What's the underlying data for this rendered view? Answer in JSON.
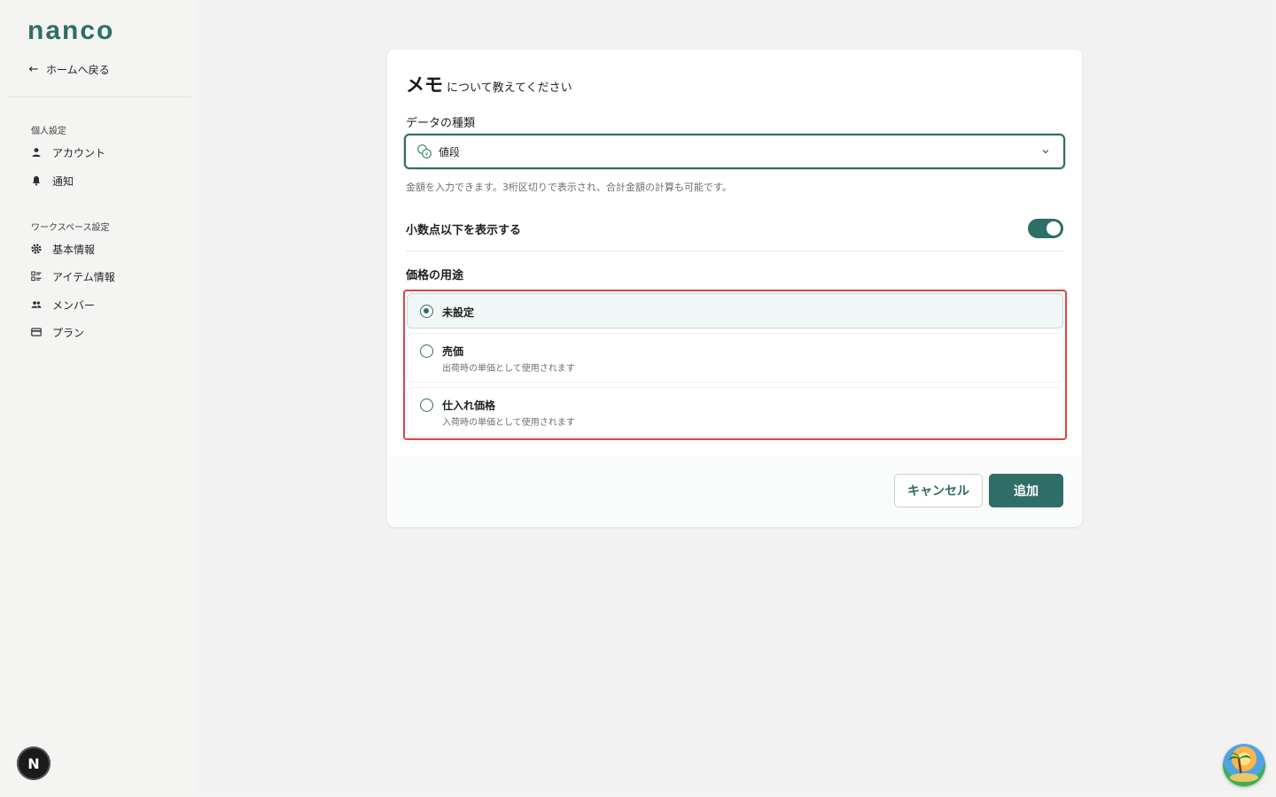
{
  "sidebar": {
    "logo": "nanco",
    "back_label": "ホームへ戻る",
    "personal_section": "個人設定",
    "personal_items": [
      {
        "label": "アカウント",
        "icon": "person-icon"
      },
      {
        "label": "通知",
        "icon": "bell-icon"
      }
    ],
    "workspace_section": "ワークスペース設定",
    "workspace_items": [
      {
        "label": "基本情報",
        "icon": "gear-icon"
      },
      {
        "label": "アイテム情報",
        "icon": "list-icon"
      },
      {
        "label": "メンバー",
        "icon": "people-icon"
      },
      {
        "label": "プラン",
        "icon": "card-icon"
      }
    ],
    "avatar_letter": "N"
  },
  "dialog": {
    "title_main": "メモ",
    "title_suffix": "について教えてください",
    "data_type_label": "データの種類",
    "data_type_value": "値段",
    "data_type_help": "金額を入力できます。3桁区切りで表示され、合計金額の計算も可能です。",
    "decimal_label": "小数点以下を表示する",
    "decimal_on": true,
    "usage_label": "価格の用途",
    "usage_options": [
      {
        "label": "未設定",
        "desc": "",
        "selected": true
      },
      {
        "label": "売価",
        "desc": "出荷時の単価として使用されます",
        "selected": false
      },
      {
        "label": "仕入れ価格",
        "desc": "入荷時の単価として使用されます",
        "selected": false
      }
    ],
    "cancel_label": "キャンセル",
    "add_label": "追加"
  },
  "colors": {
    "accent": "#2e6e66",
    "error_outline": "#d94545"
  }
}
